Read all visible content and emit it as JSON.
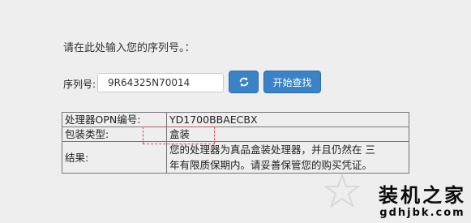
{
  "prompt": "请在此处输入您的序列号。：",
  "serial": {
    "label": "序列号:",
    "value": "9R64325N70014"
  },
  "buttons": {
    "refresh_icon": "refresh-icon",
    "search_label": "开始查找"
  },
  "result": {
    "rows": [
      {
        "key": "处理器OPN编号:",
        "value": "YD1700BBAECBX"
      },
      {
        "key": "包装类型:",
        "value": "盒装"
      },
      {
        "key": "结果:",
        "value_line1": "您的处理器为真品盒装处理器，并且仍然在 三",
        "value_line2": "年有限质保期内。请妥善保管您的购买凭证。"
      }
    ]
  },
  "watermark": {
    "title": "装机之家",
    "url": "gdhjbk.com"
  },
  "colors": {
    "button": "#3a83c6",
    "highlight_border": "#e05050",
    "background": "#eeeeee"
  }
}
